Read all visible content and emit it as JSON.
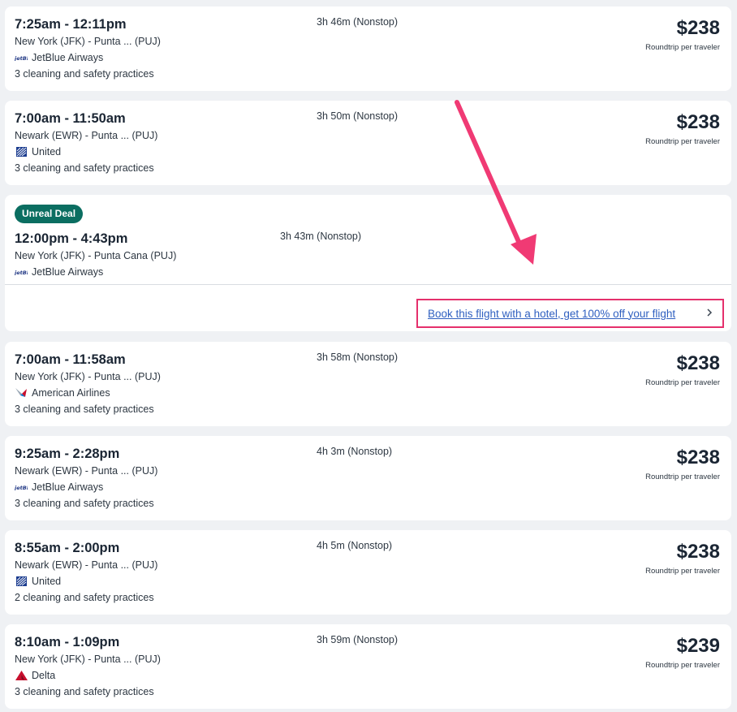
{
  "flights": [
    {
      "time": "7:25am - 12:11pm",
      "route": "New York (JFK) - Punta ... (PUJ)",
      "airline": "JetBlue Airways",
      "logo": "jetblue-logo-icon",
      "cleaning": "3 cleaning and safety practices",
      "duration": "3h 46m (Nonstop)",
      "price": "$238",
      "per": "Roundtrip per traveler"
    },
    {
      "time": "7:00am - 11:50am",
      "route": "Newark (EWR) - Punta ... (PUJ)",
      "airline": "United",
      "logo": "united-logo-icon",
      "cleaning": "3 cleaning and safety practices",
      "duration": "3h 50m (Nonstop)",
      "price": "$238",
      "per": "Roundtrip per traveler"
    },
    {
      "time": "7:00am - 11:58am",
      "route": "New York (JFK) - Punta ... (PUJ)",
      "airline": "American Airlines",
      "logo": "american-airlines-logo-icon",
      "cleaning": "3 cleaning and safety practices",
      "duration": "3h 58m (Nonstop)",
      "price": "$238",
      "per": "Roundtrip per traveler"
    },
    {
      "time": "9:25am - 2:28pm",
      "route": "Newark (EWR) - Punta ... (PUJ)",
      "airline": "JetBlue Airways",
      "logo": "jetblue-logo-icon",
      "cleaning": "3 cleaning and safety practices",
      "duration": "4h 3m (Nonstop)",
      "price": "$238",
      "per": "Roundtrip per traveler"
    },
    {
      "time": "8:55am - 2:00pm",
      "route": "Newark (EWR) - Punta ... (PUJ)",
      "airline": "United",
      "logo": "united-logo-icon",
      "cleaning": "2 cleaning and safety practices",
      "duration": "4h 5m (Nonstop)",
      "price": "$238",
      "per": "Roundtrip per traveler"
    },
    {
      "time": "8:10am - 1:09pm",
      "route": "New York (JFK) - Punta ... (PUJ)",
      "airline": "Delta",
      "logo": "delta-logo-icon",
      "cleaning": "3 cleaning and safety practices",
      "duration": "3h 59m (Nonstop)",
      "price": "$239",
      "per": "Roundtrip per traveler"
    }
  ],
  "deal": {
    "badge": "Unreal Deal",
    "time": "12:00pm - 4:43pm",
    "route": "New York (JFK) - Punta Cana (PUJ)",
    "airline": "JetBlue Airways",
    "logo": "jetblue-logo-icon",
    "duration": "3h 43m (Nonstop)",
    "promo": "Book this flight with a hotel, get 100% off your flight"
  },
  "colors": {
    "badge": "#0b6e61",
    "highlight": "#e5306c",
    "link": "#3060c0"
  }
}
